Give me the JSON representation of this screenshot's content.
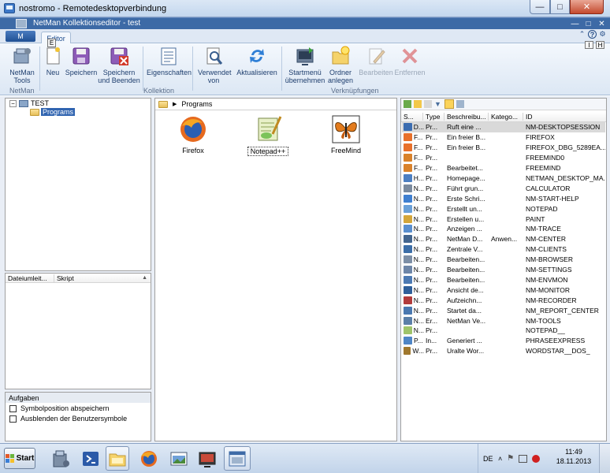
{
  "rdp": {
    "title": "nostromo - Remotedesktopverbindung"
  },
  "app": {
    "title": "NetMan Kollektionseditor - test"
  },
  "ribbon": {
    "app_menu_label": "M",
    "app_menu_keytip": "E",
    "tab_editor": "Editor",
    "help_keytips": [
      "I",
      "H"
    ],
    "buttons": {
      "netman_tools": "NetMan Tools",
      "neu": "Neu",
      "speichern": "Speichern",
      "speichern_beenden": "Speichern und Beenden",
      "eigenschaften": "Eigenschaften",
      "verwendet_von": "Verwendet von",
      "aktualisieren": "Aktualisieren",
      "startmenu": "Startmenü übernehmen",
      "ordner_anlegen": "Ordner anlegen",
      "bearbeiten": "Bearbeiten",
      "entfernen": "Entfernen"
    },
    "groups": {
      "netman": "NetMan",
      "kollektion": "Kollektion",
      "verknuepfungen": "Verknüpfungen"
    }
  },
  "tree": {
    "root": "TEST",
    "child": "Programs"
  },
  "redirect_panel": {
    "col_dateiumleit": "Dateiumleit...",
    "col_skript": "Skript"
  },
  "tasks": {
    "header": "Aufgaben",
    "items": [
      "Symbolposition abspeichern",
      "Ausblenden der Benutzersymbole"
    ]
  },
  "center": {
    "breadcrumb": "Programs",
    "icons": [
      {
        "label": "Firefox",
        "icon": "firefox-icon"
      },
      {
        "label": "Notepad++",
        "icon": "notepadpp-icon"
      },
      {
        "label": "FreeMind",
        "icon": "freemind-icon"
      }
    ]
  },
  "grid": {
    "columns": [
      "S...",
      "Type",
      "Beschreibu...",
      "Katego...",
      "ID"
    ],
    "rows": [
      {
        "s": "D...",
        "t": "Pr...",
        "d": "Ruft eine ...",
        "k": "",
        "id": "NM-DESKTOPSESSION",
        "color": "#3b6cb0"
      },
      {
        "s": "F...",
        "t": "Pr...",
        "d": "Ein freier B...",
        "k": "",
        "id": "FIREFOX",
        "color": "#e8702a"
      },
      {
        "s": "F...",
        "t": "Pr...",
        "d": "Ein freier B...",
        "k": "",
        "id": "FIREFOX_DBG_5289EA...",
        "color": "#e8702a"
      },
      {
        "s": "F...",
        "t": "Pr...",
        "d": "",
        "k": "",
        "id": "FREEMIND0",
        "color": "#d9822b"
      },
      {
        "s": "F...",
        "t": "Pr...",
        "d": "Bearbeitet...",
        "k": "",
        "id": "FREEMIND",
        "color": "#d9822b"
      },
      {
        "s": "H...",
        "t": "Pr...",
        "d": "Homepage...",
        "k": "",
        "id": "NETMAN_DESKTOP_MA...",
        "color": "#4c7fc2"
      },
      {
        "s": "N...",
        "t": "Pr...",
        "d": "Führt grun...",
        "k": "",
        "id": "CALCULATOR",
        "color": "#7a8a9e"
      },
      {
        "s": "N...",
        "t": "Pr...",
        "d": "Erste Schri...",
        "k": "",
        "id": "NM-START-HELP",
        "color": "#3f7fd0"
      },
      {
        "s": "N...",
        "t": "Pr...",
        "d": "Erstellt un...",
        "k": "",
        "id": "NOTEPAD",
        "color": "#6aa0d8"
      },
      {
        "s": "N...",
        "t": "Pr...",
        "d": "Erstellen u...",
        "k": "",
        "id": "PAINT",
        "color": "#d4a63a"
      },
      {
        "s": "N...",
        "t": "Pr...",
        "d": "Anzeigen ...",
        "k": "",
        "id": "NM-TRACE",
        "color": "#5a8fcf"
      },
      {
        "s": "N...",
        "t": "Pr...",
        "d": "NetMan D...",
        "k": "Anwen...",
        "id": "NM-CENTER",
        "color": "#44668f"
      },
      {
        "s": "N...",
        "t": "Pr...",
        "d": "Zentrale V...",
        "k": "",
        "id": "NM-CLIENTS",
        "color": "#3c6ea8"
      },
      {
        "s": "N...",
        "t": "Pr...",
        "d": "Bearbeiten...",
        "k": "",
        "id": "NM-BROWSER",
        "color": "#7d8fa6"
      },
      {
        "s": "N...",
        "t": "Pr...",
        "d": "Bearbeiten...",
        "k": "",
        "id": "NM-SETTINGS",
        "color": "#6e86a8"
      },
      {
        "s": "N...",
        "t": "Pr...",
        "d": "Bearbeiten...",
        "k": "",
        "id": "NM-ENVMON",
        "color": "#4d7ab3"
      },
      {
        "s": "N...",
        "t": "Pr...",
        "d": "Ansicht de...",
        "k": "",
        "id": "NM-MONITOR",
        "color": "#2f5f9a"
      },
      {
        "s": "N...",
        "t": "Pr...",
        "d": "Aufzeichn...",
        "k": "",
        "id": "NM-RECORDER",
        "color": "#b23b3b"
      },
      {
        "s": "N...",
        "t": "Pr...",
        "d": "Startet da...",
        "k": "",
        "id": "NM_REPORT_CENTER",
        "color": "#4a78b0"
      },
      {
        "s": "N...",
        "t": "Er...",
        "d": "NetMan Ve...",
        "k": "",
        "id": "NM-TOOLS",
        "color": "#5b7fa8"
      },
      {
        "s": "N...",
        "t": "Pr...",
        "d": "",
        "k": "",
        "id": "NOTEPAD__",
        "color": "#9fc46a"
      },
      {
        "s": "P...",
        "t": "In...",
        "d": "Generiert ...",
        "k": "",
        "id": "PHRASEEXPRESS",
        "color": "#4f86c6"
      },
      {
        "s": "W...",
        "t": "Pr...",
        "d": "Uralte Wor...",
        "k": "",
        "id": "WORDSTAR__DOS_",
        "color": "#a0782e"
      }
    ]
  },
  "taskbar": {
    "start": "Start",
    "lang": "DE",
    "time": "11:49",
    "date": "18.11.2013"
  }
}
